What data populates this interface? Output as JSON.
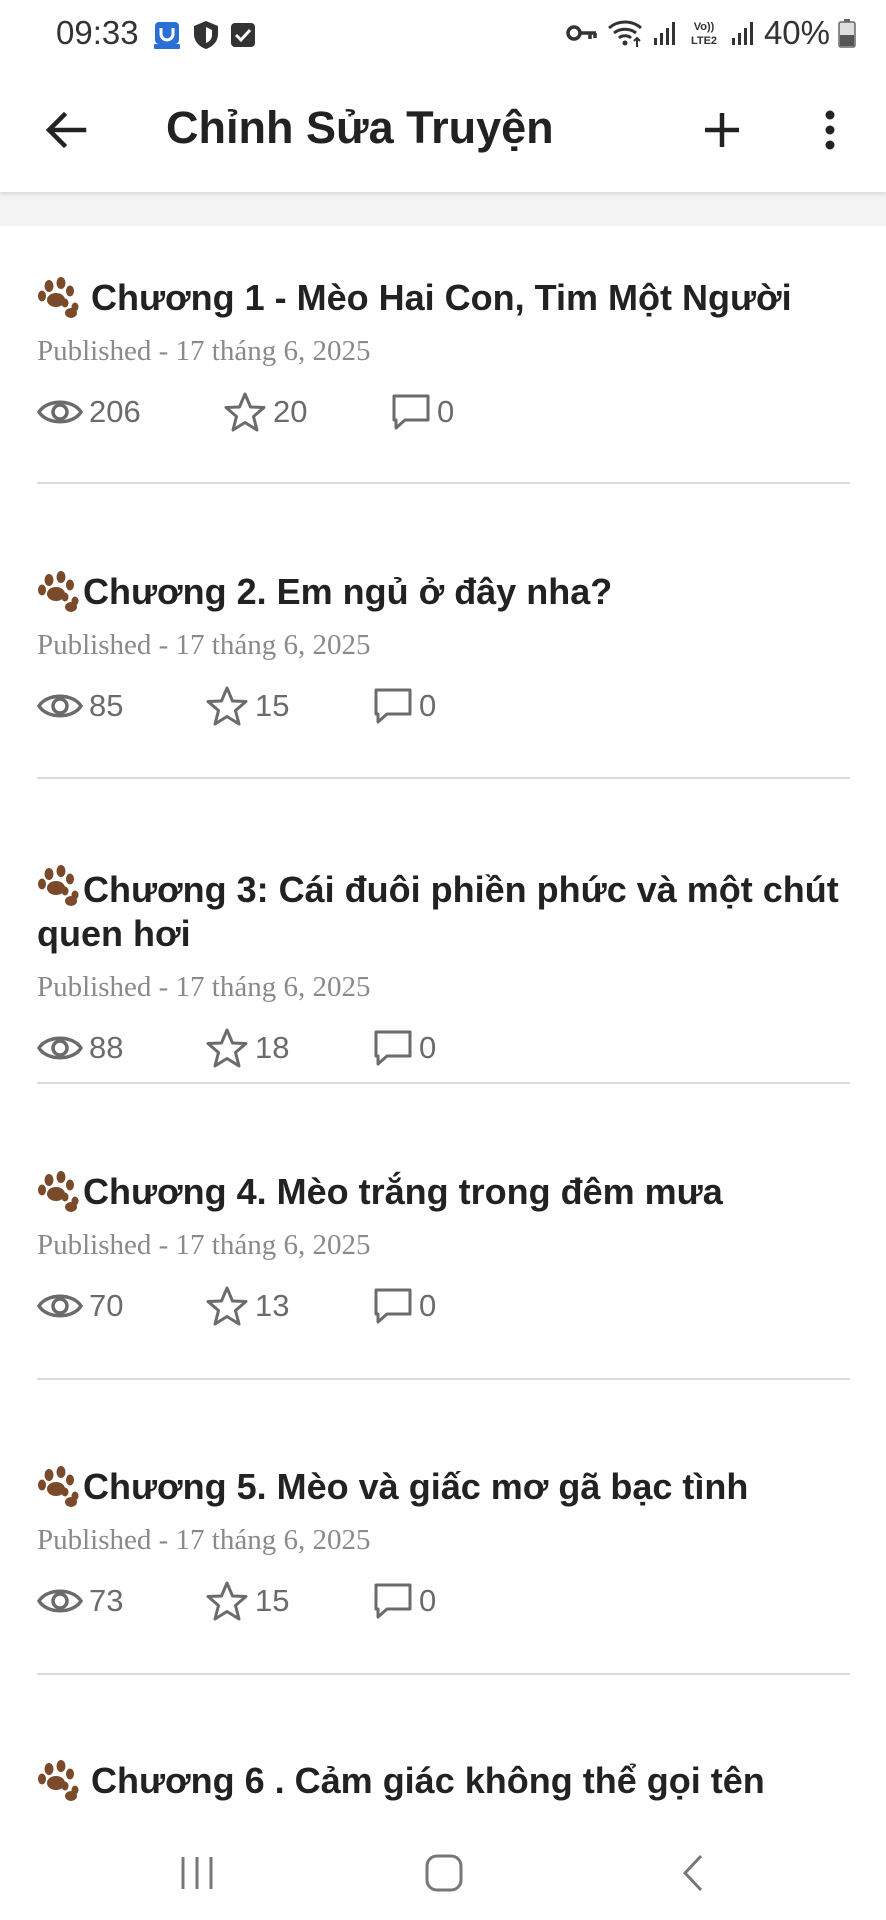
{
  "status_bar": {
    "time": "09:33",
    "battery": "40%",
    "left_icons": [
      "app-notification-icon",
      "shield-icon",
      "checkbox-icon"
    ],
    "right_icons": [
      "vpn-key-icon",
      "wifi-icon",
      "signal-icon",
      "volte-icon",
      "signal-icon",
      "battery-icon"
    ],
    "volte_label": "Vo)) LTE2"
  },
  "app_bar": {
    "title": "Chỉnh Sửa Truyện",
    "back_icon": "arrow-left-icon",
    "add_icon": "plus-icon",
    "more_icon": "more-vertical-icon"
  },
  "chapters": [
    {
      "title": "Chương 1 - Mèo Hai Con, Tim Một Người",
      "status": "Published - 17 tháng 6, 2025",
      "views": "206",
      "votes": "20",
      "comments": "0",
      "title_space": true
    },
    {
      "title": "Chương 2. Em ngủ ở đây nha?",
      "status": "Published - 17 tháng 6, 2025",
      "views": "85",
      "votes": "15",
      "comments": "0"
    },
    {
      "title": "Chương 3: Cái đuôi phiền phức và một chút quen hơi",
      "status": "Published - 17 tháng 6, 2025",
      "views": "88",
      "votes": "18",
      "comments": "0"
    },
    {
      "title": "Chương 4. Mèo trắng trong đêm mưa",
      "status": "Published - 17 tháng 6, 2025",
      "views": "70",
      "votes": "13",
      "comments": "0"
    },
    {
      "title": "Chương 5. Mèo và giấc mơ gã bạc tình",
      "status": "Published - 17 tháng 6, 2025",
      "views": "73",
      "votes": "15",
      "comments": "0"
    },
    {
      "title": "Chương 6 . Cảm giác không thể gọi tên",
      "status": "",
      "views": "",
      "votes": "",
      "comments": "",
      "title_space": true
    }
  ],
  "nav_bar": {
    "icons": [
      "recent-apps-icon",
      "home-icon",
      "back-icon"
    ]
  },
  "colors": {
    "title": "#222222",
    "meta": "#8a8a8a",
    "stats": "#6b6b6b",
    "divider": "#dcdcdc",
    "paw": "#7a4a2a"
  }
}
